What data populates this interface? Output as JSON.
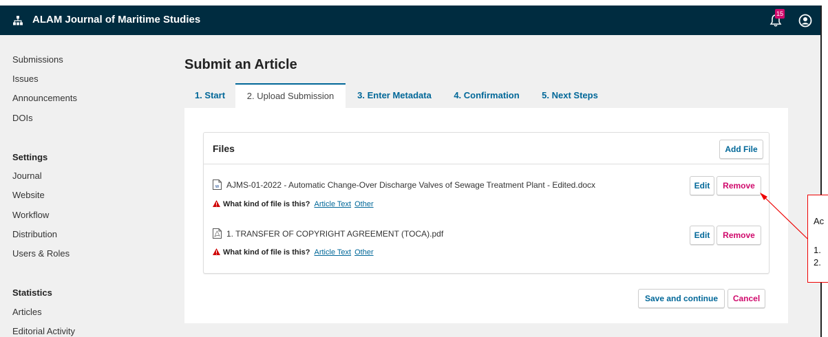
{
  "header": {
    "journal_title": "ALAM Journal of Maritime Studies",
    "notification_count": "15"
  },
  "sidebar": {
    "main_items": [
      "Submissions",
      "Issues",
      "Announcements",
      "DOIs"
    ],
    "settings_title": "Settings",
    "settings_items": [
      "Journal",
      "Website",
      "Workflow",
      "Distribution",
      "Users & Roles"
    ],
    "statistics_title": "Statistics",
    "statistics_items": [
      "Articles",
      "Editorial Activity"
    ]
  },
  "page": {
    "title": "Submit an Article",
    "tabs": [
      {
        "label": "1. Start",
        "active": false
      },
      {
        "label": "2. Upload Submission",
        "active": true
      },
      {
        "label": "3. Enter Metadata",
        "active": false
      },
      {
        "label": "4. Confirmation",
        "active": false
      },
      {
        "label": "5. Next Steps",
        "active": false
      }
    ]
  },
  "files": {
    "title": "Files",
    "add_label": "Add File",
    "items": [
      {
        "icon": "word-doc-icon",
        "name": "AJMS-01-2022 - Automatic Change-Over Discharge Valves of Sewage Treatment Plant - Edited.docx",
        "edit_label": "Edit",
        "remove_label": "Remove",
        "question": "What kind of file is this?",
        "option_1": "Article Text",
        "option_2": "Other"
      },
      {
        "icon": "pdf-icon",
        "name": "1. TRANSFER OF COPYRIGHT AGREEMENT (TOCA).pdf",
        "edit_label": "Edit",
        "remove_label": "Remove",
        "question": "What kind of file is this?",
        "option_1": "Article Text",
        "option_2": "Other"
      }
    ]
  },
  "actions": {
    "save_label": "Save and continue",
    "cancel_label": "Cancel"
  },
  "annotation": {
    "line_1": "Ac",
    "line_2": "1.",
    "line_3": "2."
  },
  "colors": {
    "header_bg": "#002c40",
    "primary": "#006798",
    "danger": "#d00a6c",
    "page_bg": "#f0f0f0",
    "annotation": "#ee0000"
  }
}
